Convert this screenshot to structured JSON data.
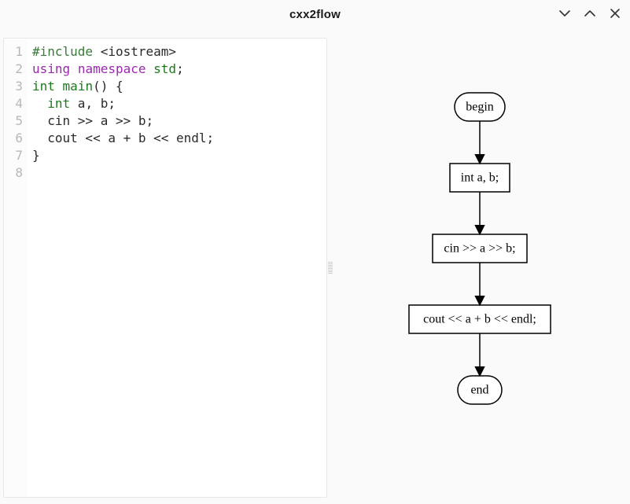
{
  "window": {
    "title": "cxx2flow",
    "controls": {
      "min": "minimize",
      "max": "maximize",
      "close": "close"
    }
  },
  "editor": {
    "line_numbers": [
      "1",
      "2",
      "3",
      "4",
      "5",
      "6",
      "7",
      "8"
    ],
    "lines": [
      [
        {
          "t": "#include ",
          "c": "tok-pre"
        },
        {
          "t": "<iostream>",
          "c": "tok-id"
        }
      ],
      [
        {
          "t": "using",
          "c": "tok-kw"
        },
        {
          "t": " ",
          "c": ""
        },
        {
          "t": "namespace",
          "c": "tok-kw"
        },
        {
          "t": " ",
          "c": ""
        },
        {
          "t": "std",
          "c": "tok-ns"
        },
        {
          "t": ";",
          "c": "tok-punc"
        }
      ],
      [
        {
          "t": "int",
          "c": "tok-type"
        },
        {
          "t": " ",
          "c": ""
        },
        {
          "t": "main",
          "c": "tok-fn"
        },
        {
          "t": "() {",
          "c": "tok-punc"
        }
      ],
      [
        {
          "t": "  ",
          "c": ""
        },
        {
          "t": "int",
          "c": "tok-type"
        },
        {
          "t": " a, b;",
          "c": "tok-id"
        }
      ],
      [
        {
          "t": "  cin >> a >> b;",
          "c": "tok-id"
        }
      ],
      [
        {
          "t": "  cout << a + b << endl;",
          "c": "tok-id"
        }
      ],
      [
        {
          "t": "}",
          "c": "tok-punc"
        }
      ],
      [
        {
          "t": "",
          "c": ""
        }
      ]
    ]
  },
  "flow": {
    "nodes": [
      {
        "id": "begin",
        "label": "begin",
        "shape": "round",
        "w": 64,
        "h": 36
      },
      {
        "id": "decl",
        "label": "int a, b;",
        "shape": "rect",
        "w": 76,
        "h": 36
      },
      {
        "id": "cin",
        "label": "cin >> a >> b;",
        "shape": "rect",
        "w": 120,
        "h": 36
      },
      {
        "id": "cout",
        "label": "cout << a + b << endl;",
        "shape": "rect",
        "w": 180,
        "h": 36
      },
      {
        "id": "end",
        "label": "end",
        "shape": "round",
        "w": 56,
        "h": 36
      }
    ],
    "vgap": 54
  }
}
